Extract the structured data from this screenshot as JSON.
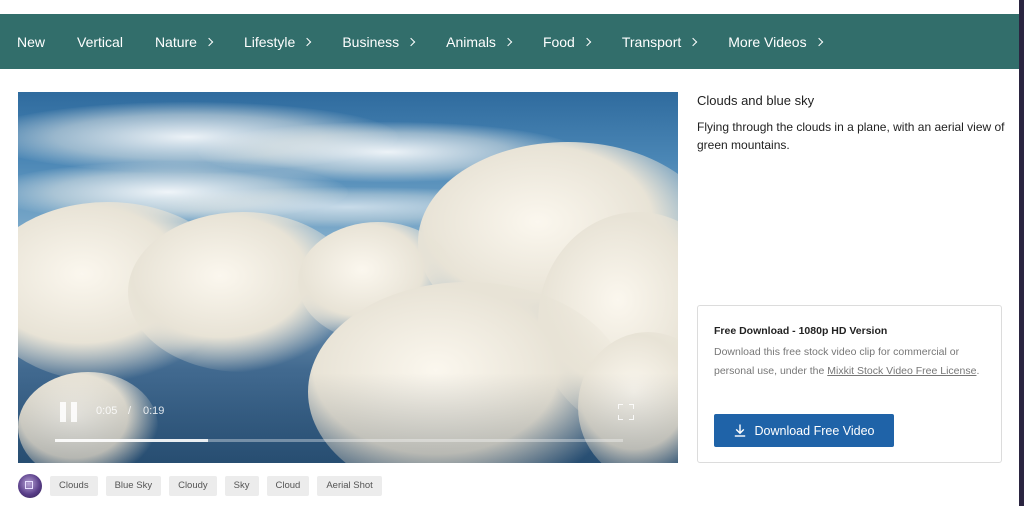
{
  "nav": {
    "items": [
      {
        "label": "New",
        "chevron": false
      },
      {
        "label": "Vertical",
        "chevron": false
      },
      {
        "label": "Nature",
        "chevron": true
      },
      {
        "label": "Lifestyle",
        "chevron": true
      },
      {
        "label": "Business",
        "chevron": true
      },
      {
        "label": "Animals",
        "chevron": true
      },
      {
        "label": "Food",
        "chevron": true
      },
      {
        "label": "Transport",
        "chevron": true
      },
      {
        "label": "More Videos",
        "chevron": true
      }
    ],
    "background": "#326e6b"
  },
  "player": {
    "current_time": "0:05",
    "separator": "/",
    "duration": "0:19",
    "progress_fraction": 0.27,
    "state": "playing"
  },
  "video_info": {
    "title": "Clouds and blue sky",
    "description": "Flying through the clouds in a plane, with an aerial view of green mountains."
  },
  "download": {
    "heading": "Free Download - 1080p HD Version",
    "text_before": "Download this free stock video clip for commercial or personal use, under the ",
    "license_link": "Mixkit Stock Video Free License",
    "text_after": ".",
    "button_label": "Download Free Video",
    "button_color": "#1f63a8"
  },
  "tags": [
    "Clouds",
    "Blue Sky",
    "Cloudy",
    "Sky",
    "Cloud",
    "Aerial Shot"
  ]
}
